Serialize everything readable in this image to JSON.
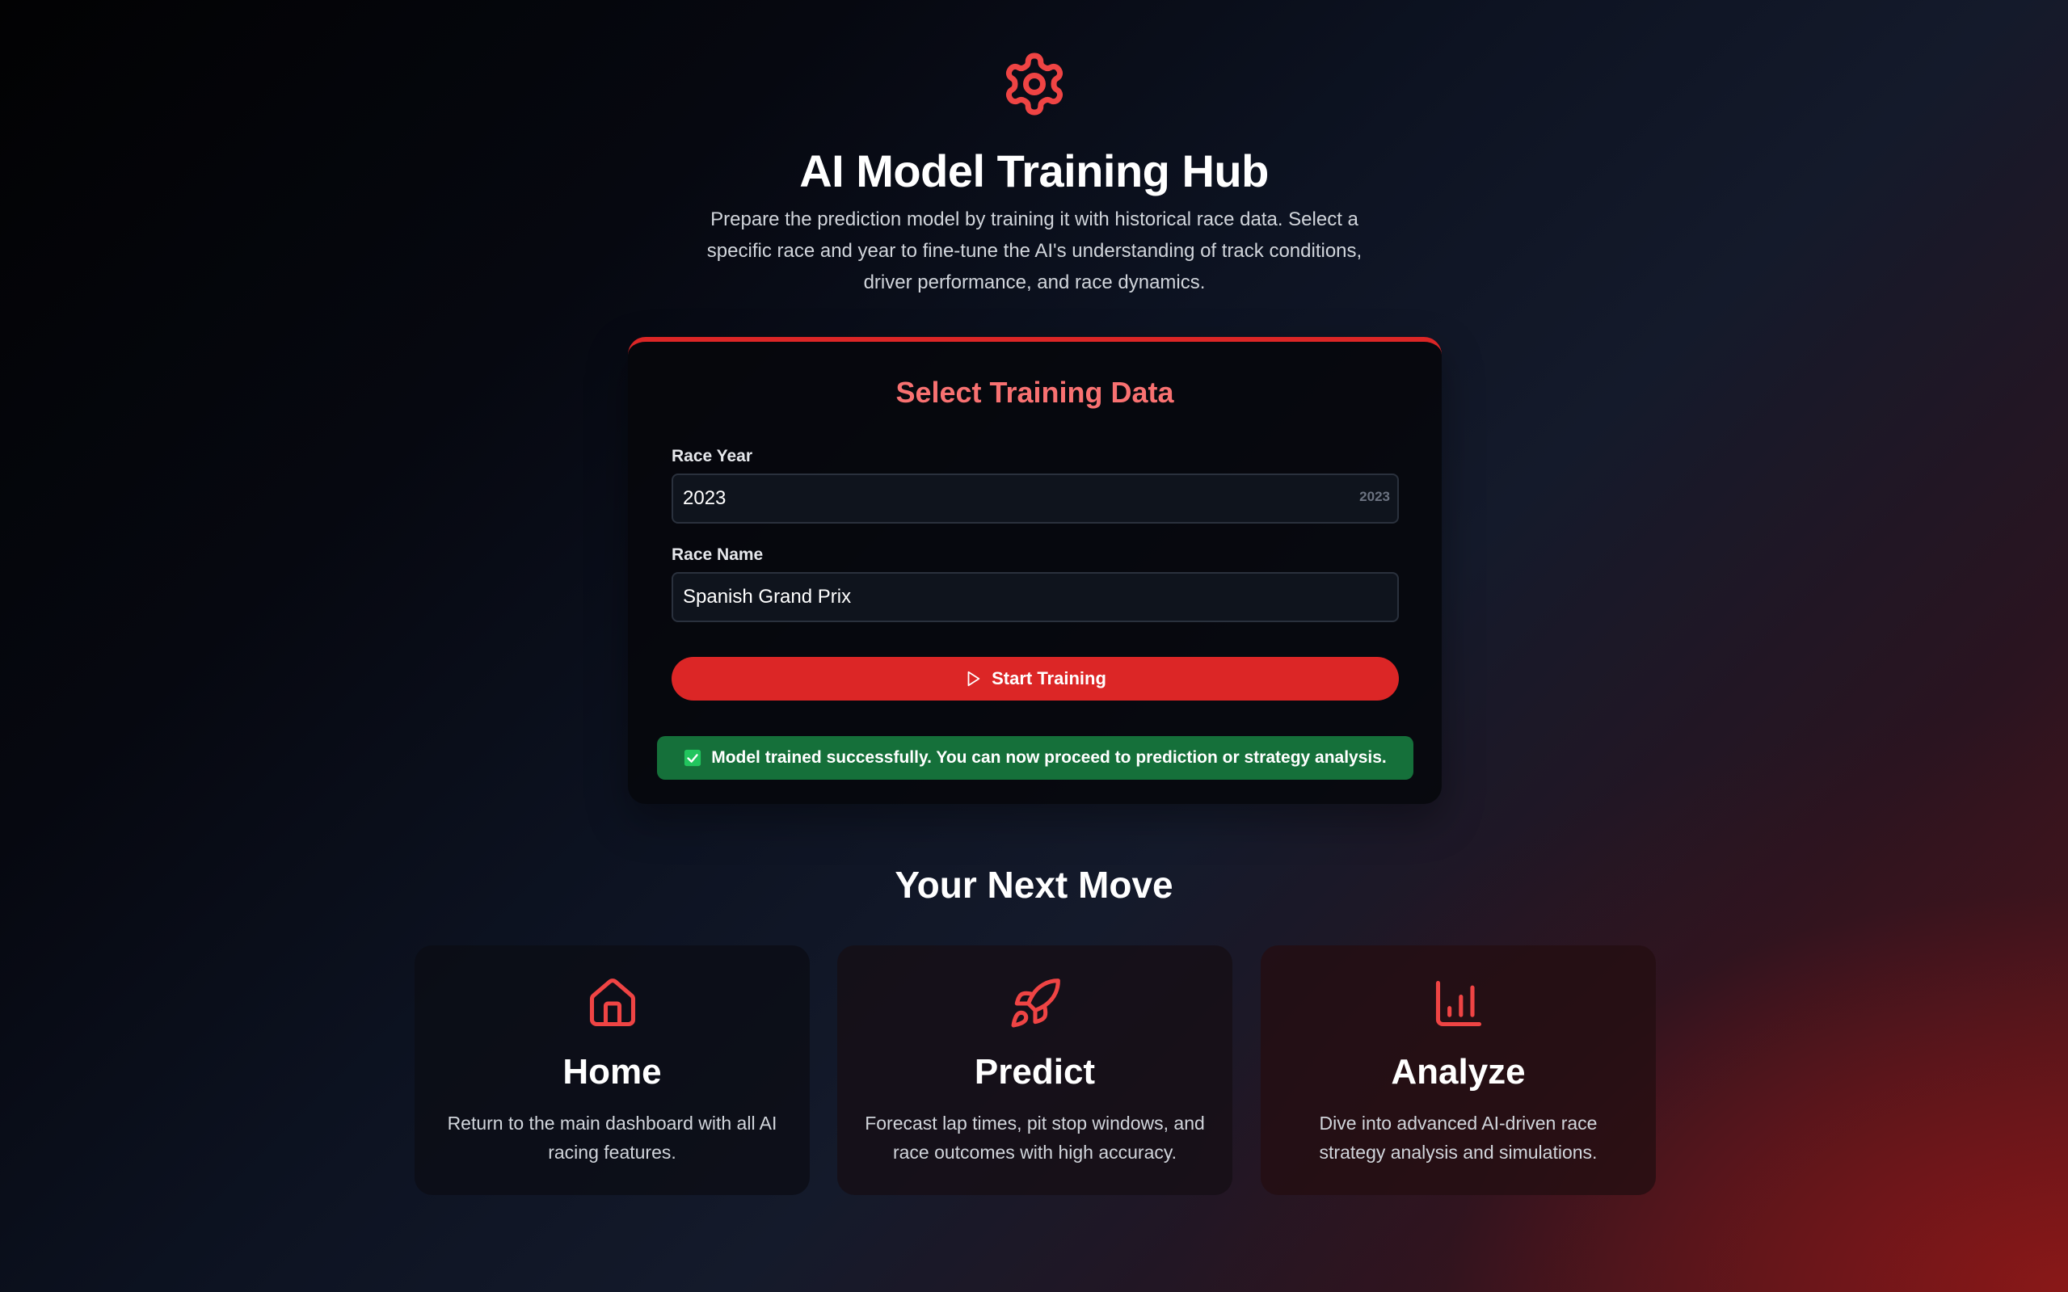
{
  "header": {
    "icon": "gear-icon",
    "title": "AI Model Training Hub",
    "subtitle": "Prepare the prediction model by training it with historical race data. Select a specific race and year to fine-tune the AI's understanding of track conditions, driver performance, and race dynamics."
  },
  "training_card": {
    "title": "Select Training Data",
    "race_year": {
      "label": "Race Year",
      "value": "2023",
      "hint": "2023"
    },
    "race_name": {
      "label": "Race Name",
      "value": "Spanish Grand Prix"
    },
    "start_button": {
      "icon": "play-icon",
      "label": "Start Training"
    },
    "status": {
      "icon": "check-icon",
      "message": "Model trained successfully. You can now proceed to prediction or strategy analysis."
    }
  },
  "next_move": {
    "title": "Your Next Move",
    "cards": [
      {
        "icon": "home-icon",
        "title": "Home",
        "description": "Return to the main dashboard with all AI racing features."
      },
      {
        "icon": "rocket-icon",
        "title": "Predict",
        "description": "Forecast lap times, pit stop windows, and race outcomes with high accuracy."
      },
      {
        "icon": "bar-chart-icon",
        "title": "Analyze",
        "description": "Dive into advanced AI-driven race strategy analysis and simulations."
      }
    ]
  },
  "colors": {
    "accent": "#dc2626",
    "accent_text": "#f87171",
    "success": "#15703a"
  }
}
